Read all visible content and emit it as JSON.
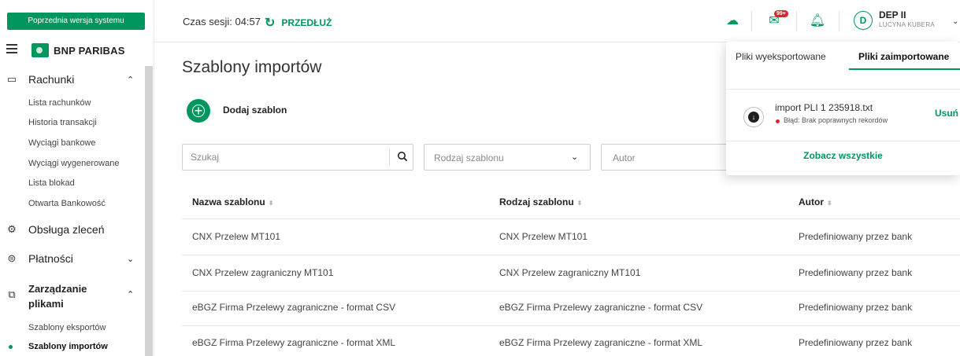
{
  "sidebar": {
    "old_version": "Poprzednia wersja systemu",
    "brand": "BNP PARIBAS",
    "groups": [
      {
        "label": "Rachunki",
        "icon": "account-card-icon"
      },
      {
        "label": "Obsługa zleceń",
        "icon": "orders-service-icon"
      },
      {
        "label": "Płatności",
        "icon": "payments-icon"
      },
      {
        "label": "Zarządzanie\nplikami",
        "icon": "files-icon"
      }
    ],
    "accounts_items": [
      "Lista rachunków",
      "Historia transakcji",
      "Wyciągi bankowe",
      "Wyciągi wygenerowane",
      "Lista blokad",
      "Otwarta Bankowość"
    ],
    "files_items": [
      "Szablony eksportów",
      "Szablony importów"
    ],
    "files_label_line1": "Zarządzanie",
    "files_label_line2": "plikami"
  },
  "topbar": {
    "session": "Czas sesji: 04:57",
    "extend": "PRZEDŁUŻ",
    "messages_badge": "99+",
    "avatar_initial": "D",
    "user_name": "DEP II",
    "user_sub": "LUCYNA KUBERA"
  },
  "main": {
    "title": "Szablony importów",
    "add_label": "Dodaj szablon",
    "search_placeholder": "Szukaj",
    "type_placeholder": "Rodzaj szablonu",
    "author_placeholder": "Autor",
    "columns": [
      "Nazwa szablonu",
      "Rodzaj szablonu",
      "Autor"
    ],
    "rows": [
      [
        "CNX Przelew MT101",
        "CNX Przelew MT101",
        "Predefiniowany przez bank"
      ],
      [
        "CNX Przelew zagraniczny MT101",
        "CNX Przelew zagraniczny MT101",
        "Predefiniowany przez bank"
      ],
      [
        "eBGZ Firma Przelewy zagraniczne - format CSV",
        "eBGZ Firma Przelewy zagraniczne - format CSV",
        "Predefiniowany przez bank"
      ],
      [
        "eBGZ Firma Przelewy zagraniczne - format XML",
        "eBGZ Firma Przelewy zagraniczne - format XML",
        "Predefiniowany przez bank"
      ]
    ]
  },
  "popover": {
    "tab_exported": "Pliki wyeksportowane",
    "tab_imported": "Pliki zaimportowane",
    "file_name": "import PLI 1 235918.txt",
    "error": "Błąd: Brak poprawnych rekordów",
    "remove": "Usuń",
    "see_all": "Zobacz wszystkie"
  },
  "colors": {
    "accent": "#00965e",
    "error": "#d8262c"
  }
}
